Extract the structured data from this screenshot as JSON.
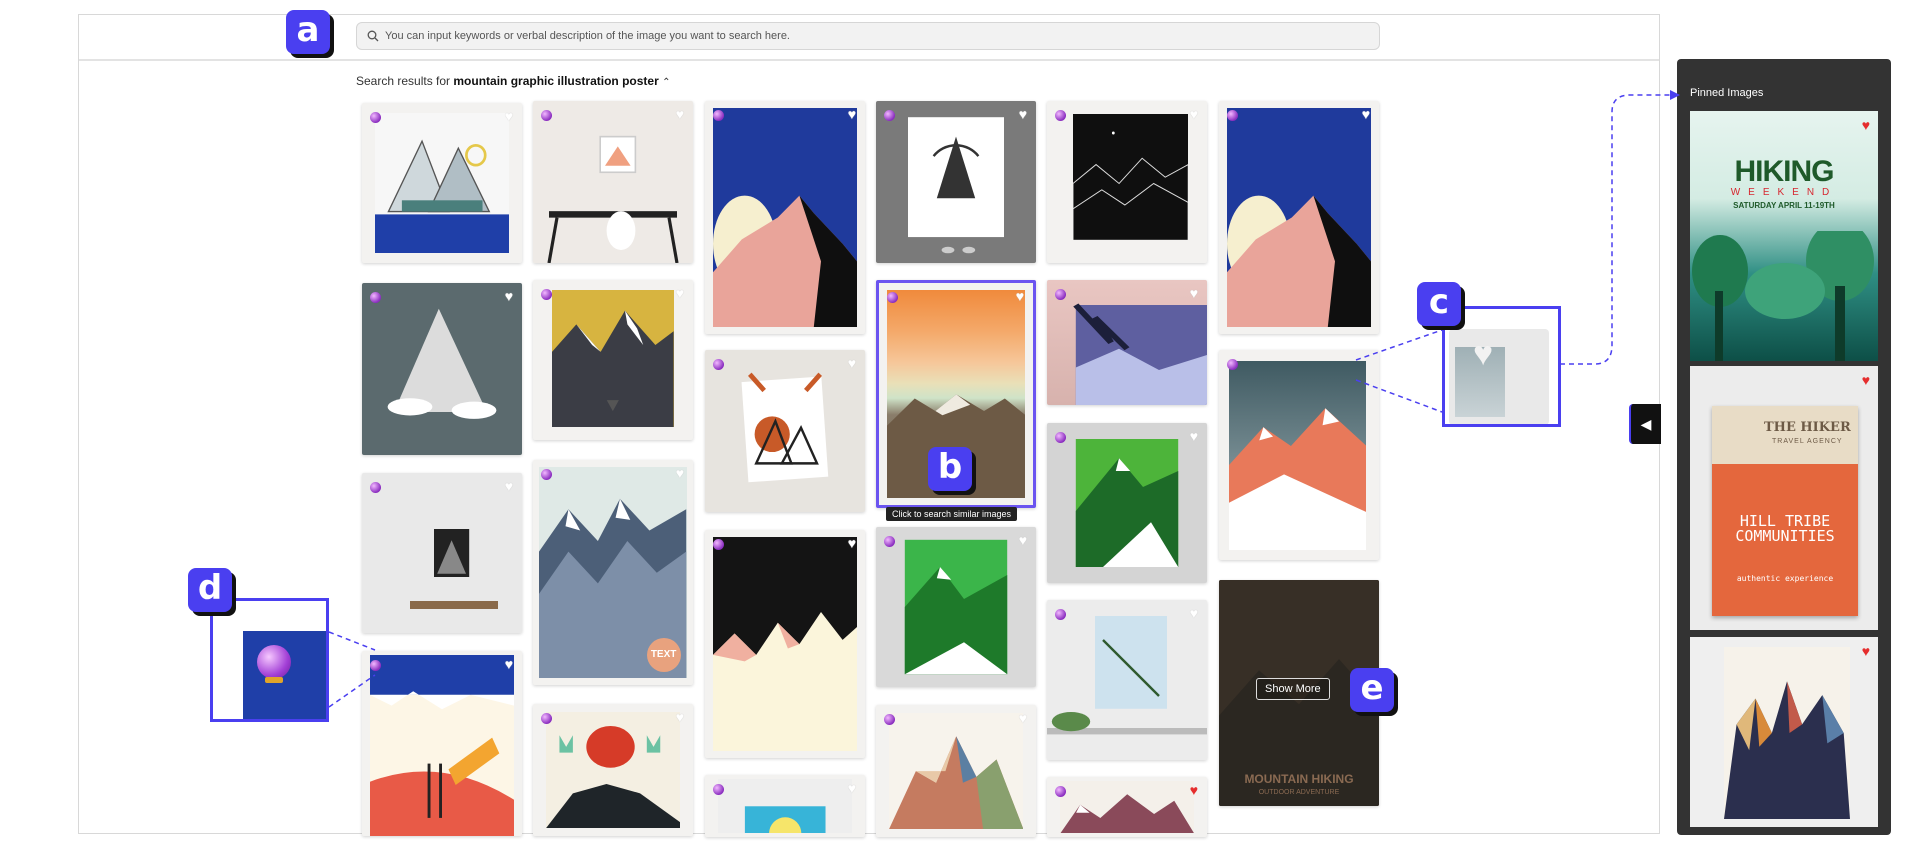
{
  "search": {
    "placeholder": "You can input keywords or verbal description of the image you want to search here."
  },
  "results": {
    "prefix": "Search results for",
    "query": "mountain graphic illustration poster",
    "toggle_icon": "chevron-up-icon"
  },
  "tooltip": "Click to search similar images",
  "show_more": "Show More",
  "callouts": {
    "a": "a",
    "b": "b",
    "c": "c",
    "d": "d",
    "e": "e"
  },
  "sidebar": {
    "title": "Pinned Images",
    "collapse_icon": "triangle-left-icon",
    "pins": [
      {
        "title": "HIKING",
        "subtitle": "WEEKEND",
        "date": "SATURDAY APRIL 11-19TH"
      },
      {
        "brand": "THE HIKER",
        "agency": "TRAVEL AGENCY",
        "headline": "HILL TRIBE COMMUNITIES",
        "tagline": "authentic experience"
      },
      {
        "label": ""
      }
    ]
  },
  "grid": {
    "tiles": [
      {
        "liked": false
      },
      {
        "liked": false
      },
      {
        "liked": false
      },
      {
        "liked": false
      },
      {
        "liked": false
      },
      {
        "liked": false
      },
      {
        "liked": false
      },
      {
        "liked": false
      },
      {
        "liked": false
      },
      {
        "liked": false
      },
      {
        "liked": false
      },
      {
        "liked": false
      },
      {
        "liked": false
      },
      {
        "liked": false
      },
      {
        "liked": false
      },
      {
        "liked": false
      },
      {
        "liked": false
      },
      {
        "liked": false
      },
      {
        "liked": false
      },
      {
        "liked": false
      },
      {
        "liked": false
      },
      {
        "liked": false
      },
      {
        "liked": false
      },
      {
        "liked": true
      }
    ],
    "text_badge": "TEXT",
    "last_poster": {
      "title": "MOUNTAIN HIKING",
      "subtitle": "OUTDOOR ADVENTURE"
    }
  },
  "colors": {
    "accent": "#4a3ff0",
    "heart_active": "#e52d2d",
    "sidebar": "#333333"
  }
}
